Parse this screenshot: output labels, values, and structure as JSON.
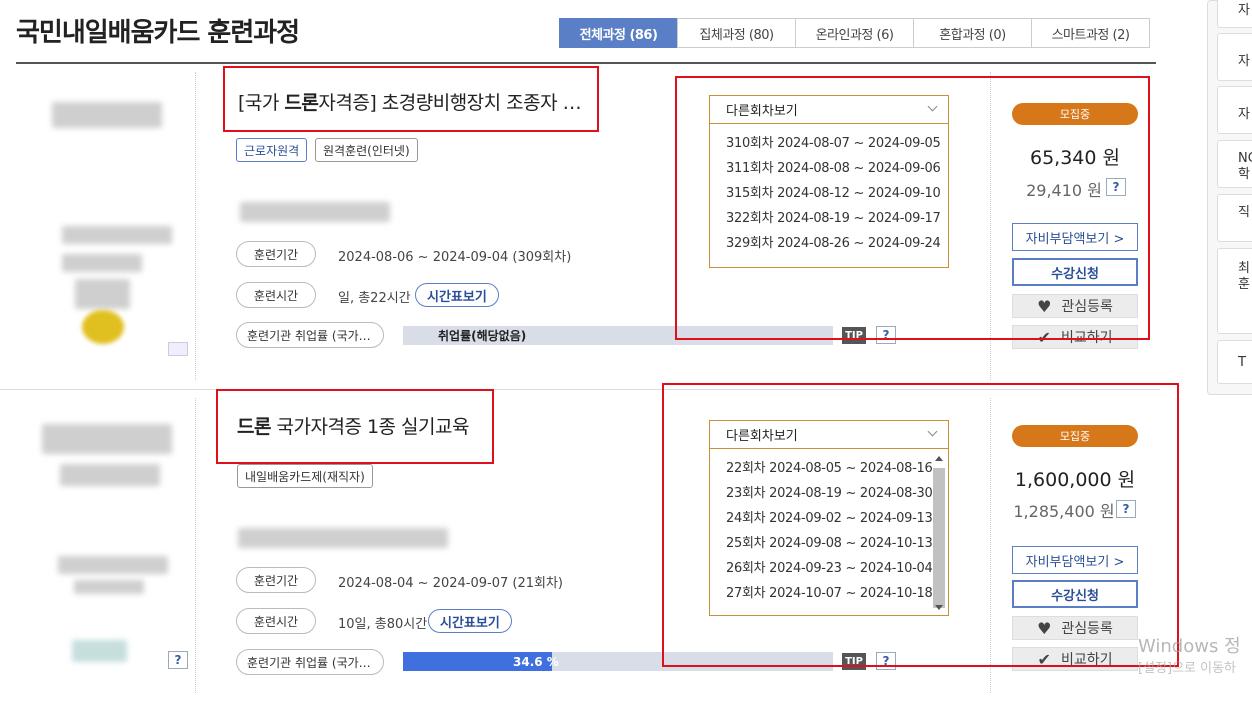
{
  "page": {
    "title": "국민내일배움카드 훈련과정"
  },
  "tabs": [
    {
      "label": "전체과정 (86)",
      "active": true
    },
    {
      "label": "집체과정 (80)",
      "active": false
    },
    {
      "label": "온라인과정 (6)",
      "active": false
    },
    {
      "label": "혼합과정 (0)",
      "active": false
    },
    {
      "label": "스마트과정 (2)",
      "active": false
    }
  ],
  "side": {
    "items": [
      "자",
      "자",
      "NC 학",
      "직",
      "최 훈",
      "T"
    ]
  },
  "courses": [
    {
      "title_prefix": "[국가 ",
      "title_bold": "드론",
      "title_rest": "자격증] 초경량비행장치 조종자 …",
      "chips": [
        "근로자원격",
        "원격훈련(인터넷)"
      ],
      "period_label": "훈련기간",
      "period_value": "2024-08-06 ~ 2024-09-04 (309회차)",
      "time_label": "훈련시간",
      "time_value": "일, 총22시간",
      "time_button": "시간표보기",
      "employment_label": "훈련기관 취업률 (국가…",
      "employment_text": "취업률(해당없음)",
      "employment_rate": 0,
      "tip": "TIP",
      "help": "?",
      "schedule_header": "다른회차보기",
      "schedule": [
        "310회차 2024-08-07 ~ 2024-09-05",
        "311회차 2024-08-08 ~ 2024-09-06",
        "315회차 2024-08-12 ~ 2024-09-10",
        "322회차 2024-08-19 ~ 2024-09-17",
        "329회차 2024-08-26 ~ 2024-09-24"
      ],
      "badge": "모집중",
      "price": "65,340 원",
      "price_self": "29,410 원",
      "btn_self_pay": "자비부담액보기 >",
      "btn_apply": "수강신청",
      "btn_interest": "관심등록",
      "btn_compare": "비교하기"
    },
    {
      "title_prefix": "",
      "title_bold": "드론",
      "title_rest": " 국가자격증 1종 실기교육",
      "chips": [
        "내일배움카드제(재직자)"
      ],
      "period_label": "훈련기간",
      "period_value": "2024-08-04 ~ 2024-09-07 (21회차)",
      "time_label": "훈련시간",
      "time_value": "10일, 총80시간",
      "time_button": "시간표보기",
      "employment_label": "훈련기관 취업률 (국가…",
      "employment_text": "34.6 %",
      "employment_rate": 34.6,
      "tip": "TIP",
      "help": "?",
      "schedule_header": "다른회차보기",
      "schedule": [
        "22회차 2024-08-05 ~ 2024-08-16",
        "23회차 2024-08-19 ~ 2024-08-30",
        "24회차 2024-09-02 ~ 2024-09-13",
        "25회차 2024-09-08 ~ 2024-10-13",
        "26회차 2024-09-23 ~ 2024-10-04",
        "27회차 2024-10-07 ~ 2024-10-18"
      ],
      "badge": "모집중",
      "price": "1,600,000 원",
      "price_self": "1,285,400 원",
      "btn_self_pay": "자비부담액보기 >",
      "btn_apply": "수강신청",
      "btn_interest": "관심등록",
      "btn_compare": "비교하기"
    }
  ],
  "watermark": {
    "line1": "Windows 정",
    "line2": "[설정]으로 이동하"
  },
  "colors": {
    "accent": "#5a7fc6",
    "badge": "#d6781a",
    "highlight": "#e0101a",
    "bar_fill": "#4070e0"
  }
}
